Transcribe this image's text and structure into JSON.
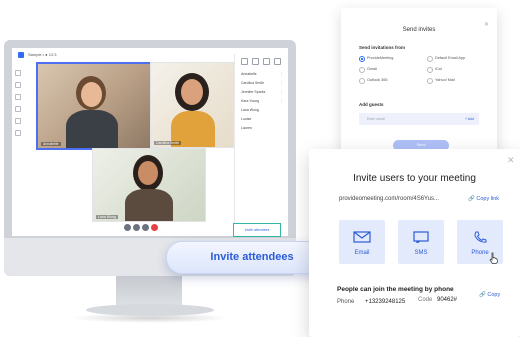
{
  "app": {
    "meeting_name": "Sample • ● 12:3",
    "left_rail_icons": [
      "mic-icon",
      "camera-icon",
      "share-icon",
      "chat-icon",
      "users-icon",
      "settings-icon"
    ],
    "tile_labels": [
      "Annabelle",
      "Carolina Smith",
      "Lana Wong"
    ],
    "right_panel": {
      "rows": [
        "Annabelle",
        "Carolina Smith",
        "Jennifer Sparks",
        "Kara Young",
        "Lana Wong",
        "Louise",
        "Lauren"
      ],
      "invite_button": "Invite attendees"
    }
  },
  "invite_pill": {
    "label": "Invite attendees"
  },
  "send_invites": {
    "title": "Send invites",
    "send_from_label": "Send invitations from",
    "options": [
      {
        "label": "ProvideMeeting",
        "selected": true
      },
      {
        "label": "Default Email App",
        "selected": false
      },
      {
        "label": "Gmail",
        "selected": false
      },
      {
        "label": "iCal",
        "selected": false
      },
      {
        "label": "Outlook 365",
        "selected": false
      },
      {
        "label": "Yahoo! Mail",
        "selected": false
      }
    ],
    "add_guests_label": "Add guests",
    "email_placeholder": "Enter email",
    "add_label": "+ Add",
    "send_label": "Send"
  },
  "invite_users": {
    "title": "Invite users to your meeting",
    "link": "provideomeeting.com/room/4S6Yus...",
    "copy_link_label": "Copy link",
    "options": [
      {
        "label": "Email",
        "icon": "mail-icon"
      },
      {
        "label": "SMS",
        "icon": "chat-icon"
      },
      {
        "label": "Phone",
        "icon": "phone-icon"
      }
    ],
    "phone_title": "People can join the meeting by phone",
    "phone_label": "Phone",
    "phone_number": "+13239248125",
    "code_label": "Code",
    "code_value": "90462#",
    "copy_label": "Copy"
  },
  "colors": {
    "accent": "#2c5cd6",
    "tile_highlight": "#4d6ff2",
    "send_button": "#aec0f7"
  }
}
